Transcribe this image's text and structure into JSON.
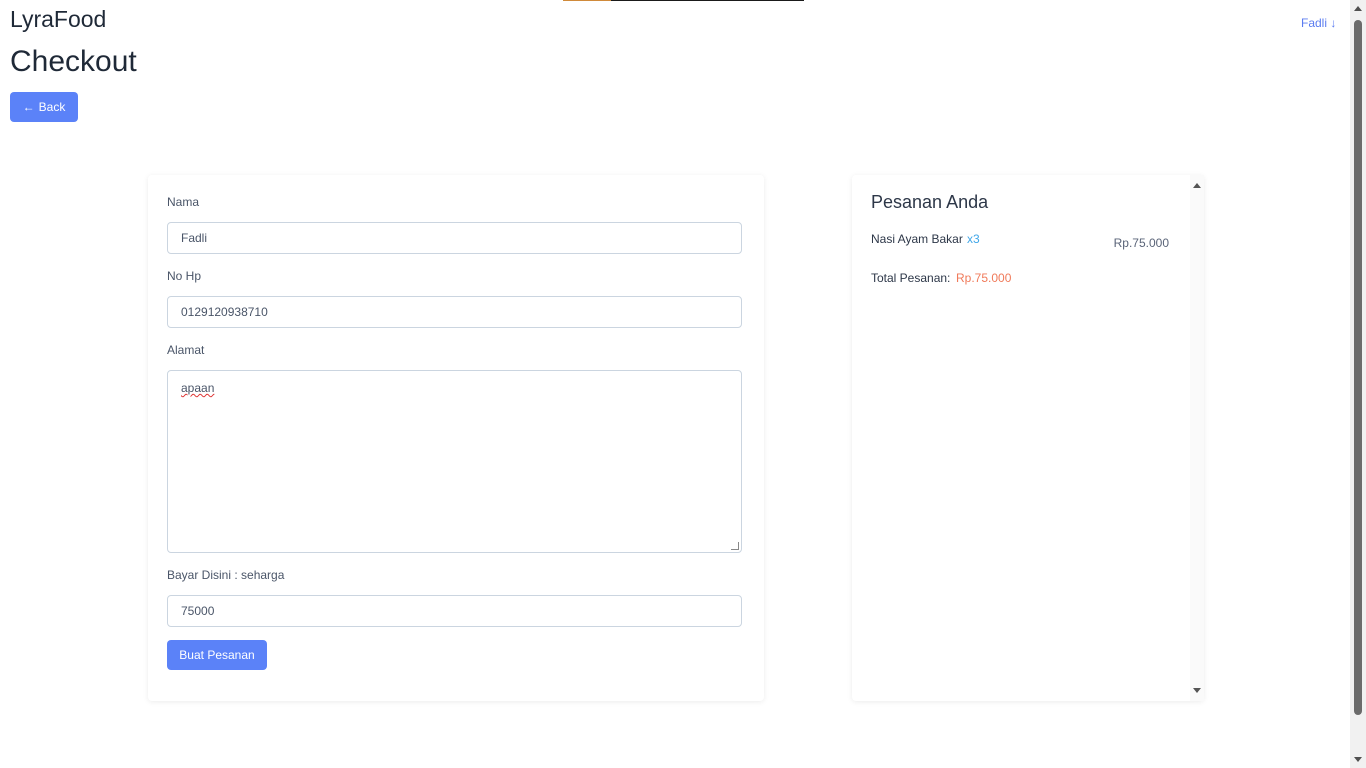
{
  "header": {
    "brand": "LyraFood",
    "user_menu": "Fadli ↓",
    "page_title": "Checkout",
    "back_arrow": "←",
    "back_label": "Back"
  },
  "loading_bar": {
    "progress_fraction": 0.2
  },
  "form": {
    "name_label": "Nama",
    "name_value": "Fadli",
    "phone_label": "No Hp",
    "phone_value": "0129120938710",
    "address_label": "Alamat",
    "address_value": "apaan",
    "pay_label": "Bayar Disini : seharga",
    "pay_value": "75000",
    "submit_label": "Buat Pesanan"
  },
  "order": {
    "title": "Pesanan Anda",
    "items": [
      {
        "name": "Nasi Ayam Bakar",
        "qty": "x3",
        "price": "Rp.75.000"
      }
    ],
    "total_label": "Total Pesanan:",
    "total_value": "Rp.75.000"
  },
  "colors": {
    "accent": "#5b82f8",
    "link": "#5b7cf0",
    "qty": "#3fa6e8",
    "total": "#f07a5a"
  }
}
